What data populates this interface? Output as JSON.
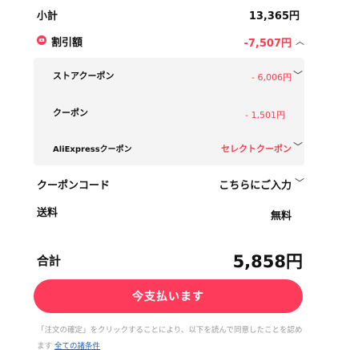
{
  "summary": {
    "subtotal_label": "小計",
    "subtotal_value": "13,365円",
    "discount_label": "割引額",
    "discount_value": "-7,507円",
    "coupons": [
      {
        "label": "ストアクーポン",
        "value": "- 6,006円",
        "has_chevron": true
      },
      {
        "label": "クーポン",
        "value": "- 1,501円",
        "has_chevron": false
      },
      {
        "label": "AliExpressクーポン",
        "value": "セレクトクーポン",
        "has_chevron": true
      }
    ],
    "coupon_code_label": "クーポンコード",
    "coupon_code_value": "こちらにご入力",
    "shipping_label": "送料",
    "shipping_value": "無料",
    "total_label": "合計",
    "total_value": "5,858円"
  },
  "actions": {
    "pay_label": "今支払います"
  },
  "terms": {
    "text": "「注文の確定」をクリックすることにより、以下を読んで同意したことを認めます",
    "link": "全ての諸条件"
  },
  "colors": {
    "accent": "#ff3b5c",
    "discount": "#ff3b4e"
  },
  "icons": {
    "coupon": "coupon-icon",
    "chevron_up": "chevron-up-icon",
    "chevron_down": "chevron-down-icon"
  }
}
